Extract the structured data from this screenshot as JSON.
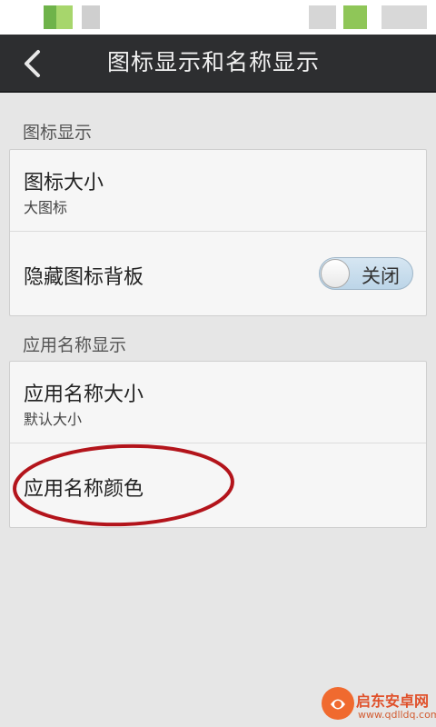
{
  "header": {
    "title": "图标显示和名称显示"
  },
  "sections": [
    {
      "label": "图标显示",
      "items": [
        {
          "title": "图标大小",
          "subtitle": "大图标"
        },
        {
          "title": "隐藏图标背板",
          "toggle": {
            "state_label": "关闭",
            "on": false
          }
        }
      ]
    },
    {
      "label": "应用名称显示",
      "items": [
        {
          "title": "应用名称大小",
          "subtitle": "默认大小"
        },
        {
          "title": "应用名称颜色"
        }
      ]
    }
  ],
  "watermark": {
    "text": "启东安卓网",
    "url": "www.qdlldq.com"
  },
  "colors": {
    "titlebar_bg": "#2d2e30",
    "page_bg": "#e6e6e6",
    "card_bg": "#f6f6f6",
    "annotation": "#b3141b",
    "toggle_fill": "#c6dbeb"
  }
}
